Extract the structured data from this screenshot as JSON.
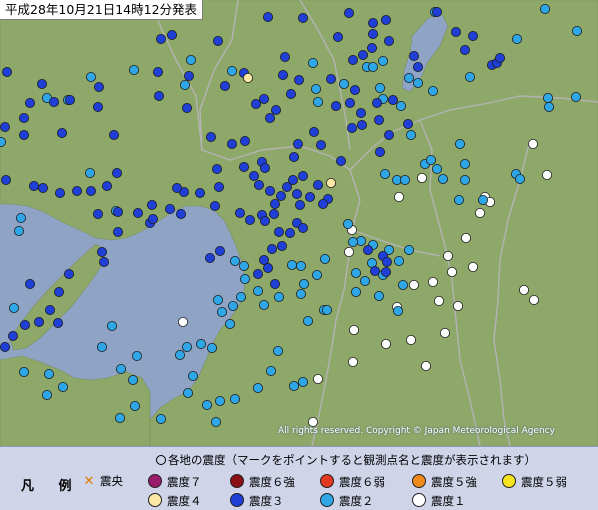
{
  "title": "平成28年10月21日14時12分発表",
  "copyright": "All rights reserved. Copyright © Japan Meteorological Agency",
  "legend": {
    "heading": "各地の震度（マークをポイントすると観測点名と震度が表示されます）",
    "label": "凡 例",
    "items": [
      {
        "key": "epicenter",
        "label": "震央",
        "symbol": "x-icon",
        "color": "#e8881a"
      },
      {
        "key": "s7",
        "label": "震度７",
        "color": "#9a1a6b"
      },
      {
        "key": "s6p",
        "label": "震度６強",
        "color": "#8a0f17"
      },
      {
        "key": "s6m",
        "label": "震度６弱",
        "color": "#e23a21"
      },
      {
        "key": "s5p",
        "label": "震度５強",
        "color": "#f08a1a"
      },
      {
        "key": "s5m",
        "label": "震度５弱",
        "color": "#f5e41e"
      },
      {
        "key": "s4",
        "label": "震度４",
        "color": "#fbe7a6"
      },
      {
        "key": "s3",
        "label": "震度３",
        "color": "#1f3fd6"
      },
      {
        "key": "s2",
        "label": "震度２",
        "color": "#2fa6e6"
      },
      {
        "key": "s1",
        "label": "震度１",
        "color": "#ffffff"
      }
    ]
  },
  "map_colors": {
    "land": "#8ea86a",
    "sea": "#8fa4c4",
    "border": "#a9a9a9"
  },
  "stations": {
    "s4": [
      [
        248,
        78
      ],
      [
        331,
        183
      ]
    ],
    "s3": [
      [
        7,
        72
      ],
      [
        42,
        84
      ],
      [
        30,
        103
      ],
      [
        54,
        102
      ],
      [
        70,
        100
      ],
      [
        24,
        118
      ],
      [
        5,
        127
      ],
      [
        62,
        133
      ],
      [
        24,
        135
      ],
      [
        99,
        87
      ],
      [
        98,
        107
      ],
      [
        114,
        135
      ],
      [
        117,
        173
      ],
      [
        107,
        186
      ],
      [
        91,
        191
      ],
      [
        77,
        191
      ],
      [
        60,
        193
      ],
      [
        43,
        188
      ],
      [
        6,
        180
      ],
      [
        34,
        186
      ],
      [
        152,
        205
      ],
      [
        138,
        213
      ],
      [
        150,
        223
      ],
      [
        153,
        219
      ],
      [
        118,
        232
      ],
      [
        98,
        214
      ],
      [
        118,
        212
      ],
      [
        184,
        192
      ],
      [
        200,
        193
      ],
      [
        219,
        187
      ],
      [
        177,
        188
      ],
      [
        170,
        209
      ],
      [
        181,
        214
      ],
      [
        215,
        206
      ],
      [
        217,
        169
      ],
      [
        211,
        137
      ],
      [
        232,
        144
      ],
      [
        244,
        167
      ],
      [
        245,
        141
      ],
      [
        262,
        162
      ],
      [
        254,
        176
      ],
      [
        265,
        168
      ],
      [
        259,
        185
      ],
      [
        270,
        191
      ],
      [
        275,
        204
      ],
      [
        281,
        196
      ],
      [
        287,
        187
      ],
      [
        293,
        180
      ],
      [
        297,
        194
      ],
      [
        303,
        176
      ],
      [
        300,
        205
      ],
      [
        310,
        197
      ],
      [
        318,
        185
      ],
      [
        328,
        199
      ],
      [
        321,
        145
      ],
      [
        314,
        132
      ],
      [
        298,
        144
      ],
      [
        294,
        157
      ],
      [
        270,
        118
      ],
      [
        276,
        110
      ],
      [
        291,
        94
      ],
      [
        283,
        75
      ],
      [
        285,
        57
      ],
      [
        256,
        104
      ],
      [
        264,
        99
      ],
      [
        299,
        80
      ],
      [
        336,
        106
      ],
      [
        331,
        79
      ],
      [
        353,
        60
      ],
      [
        363,
        55
      ],
      [
        355,
        90
      ],
      [
        350,
        103
      ],
      [
        361,
        113
      ],
      [
        352,
        128
      ],
      [
        362,
        125
      ],
      [
        341,
        161
      ],
      [
        323,
        204
      ],
      [
        274,
        214
      ],
      [
        262,
        215
      ],
      [
        279,
        232
      ],
      [
        272,
        249
      ],
      [
        282,
        246
      ],
      [
        264,
        260
      ],
      [
        268,
        268
      ],
      [
        258,
        274
      ],
      [
        275,
        284
      ],
      [
        240,
        213
      ],
      [
        250,
        220
      ],
      [
        265,
        221
      ],
      [
        297,
        223
      ],
      [
        303,
        228
      ],
      [
        290,
        233
      ],
      [
        244,
        73
      ],
      [
        225,
        86
      ],
      [
        189,
        76
      ],
      [
        187,
        108
      ],
      [
        159,
        96
      ],
      [
        158,
        72
      ],
      [
        161,
        39
      ],
      [
        218,
        41
      ],
      [
        268,
        17
      ],
      [
        303,
        18
      ],
      [
        338,
        37
      ],
      [
        349,
        13
      ],
      [
        373,
        34
      ],
      [
        373,
        23
      ],
      [
        386,
        20
      ],
      [
        389,
        41
      ],
      [
        372,
        48
      ],
      [
        377,
        103
      ],
      [
        379,
        120
      ],
      [
        393,
        100
      ],
      [
        414,
        56
      ],
      [
        418,
        67
      ],
      [
        456,
        32
      ],
      [
        465,
        50
      ],
      [
        437,
        12
      ],
      [
        473,
        36
      ],
      [
        492,
        65
      ],
      [
        497,
        63
      ],
      [
        500,
        58
      ],
      [
        389,
        135
      ],
      [
        380,
        152
      ],
      [
        408,
        124
      ],
      [
        368,
        250
      ],
      [
        383,
        256
      ],
      [
        387,
        262
      ],
      [
        375,
        271
      ],
      [
        386,
        272
      ],
      [
        69,
        274
      ],
      [
        59,
        292
      ],
      [
        50,
        310
      ],
      [
        30,
        284
      ],
      [
        102,
        252
      ],
      [
        104,
        262
      ],
      [
        58,
        323
      ],
      [
        39,
        322
      ],
      [
        25,
        325
      ],
      [
        13,
        336
      ],
      [
        5,
        347
      ],
      [
        178,
        9
      ],
      [
        172,
        35
      ],
      [
        210,
        258
      ],
      [
        220,
        251
      ]
    ],
    "s2": [
      [
        1,
        142
      ],
      [
        21,
        218
      ],
      [
        19,
        231
      ],
      [
        14,
        308
      ],
      [
        24,
        372
      ],
      [
        49,
        374
      ],
      [
        63,
        387
      ],
      [
        47,
        395
      ],
      [
        112,
        326
      ],
      [
        102,
        347
      ],
      [
        121,
        369
      ],
      [
        133,
        380
      ],
      [
        137,
        356
      ],
      [
        135,
        406
      ],
      [
        120,
        418
      ],
      [
        161,
        419
      ],
      [
        180,
        355
      ],
      [
        187,
        347
      ],
      [
        212,
        348
      ],
      [
        193,
        376
      ],
      [
        201,
        344
      ],
      [
        222,
        312
      ],
      [
        230,
        324
      ],
      [
        233,
        306
      ],
      [
        241,
        297
      ],
      [
        245,
        279
      ],
      [
        258,
        291
      ],
      [
        279,
        297
      ],
      [
        292,
        265
      ],
      [
        301,
        266
      ],
      [
        301,
        294
      ],
      [
        304,
        284
      ],
      [
        317,
        275
      ],
      [
        325,
        259
      ],
      [
        308,
        321
      ],
      [
        324,
        310
      ],
      [
        271,
        371
      ],
      [
        294,
        386
      ],
      [
        303,
        382
      ],
      [
        258,
        388
      ],
      [
        235,
        399
      ],
      [
        220,
        401
      ],
      [
        207,
        405
      ],
      [
        216,
        422
      ],
      [
        188,
        393
      ],
      [
        348,
        224
      ],
      [
        361,
        241
      ],
      [
        353,
        242
      ],
      [
        373,
        245
      ],
      [
        389,
        250
      ],
      [
        372,
        263
      ],
      [
        356,
        273
      ],
      [
        365,
        281
      ],
      [
        356,
        292
      ],
      [
        379,
        296
      ],
      [
        383,
        275
      ],
      [
        409,
        250
      ],
      [
        399,
        261
      ],
      [
        403,
        285
      ],
      [
        398,
        311
      ],
      [
        327,
        310
      ],
      [
        278,
        351
      ],
      [
        235,
        261
      ],
      [
        244,
        266
      ],
      [
        218,
        300
      ],
      [
        264,
        305
      ],
      [
        411,
        135
      ],
      [
        425,
        164
      ],
      [
        397,
        180
      ],
      [
        405,
        180
      ],
      [
        385,
        174
      ],
      [
        431,
        160
      ],
      [
        443,
        179
      ],
      [
        465,
        180
      ],
      [
        465,
        164
      ],
      [
        483,
        200
      ],
      [
        459,
        200
      ],
      [
        437,
        169
      ],
      [
        418,
        83
      ],
      [
        470,
        77
      ],
      [
        516,
        174
      ],
      [
        520,
        179
      ],
      [
        548,
        98
      ],
      [
        576,
        97
      ],
      [
        549,
        107
      ],
      [
        517,
        39
      ],
      [
        577,
        31
      ],
      [
        545,
        9
      ],
      [
        435,
        12
      ],
      [
        383,
        61
      ],
      [
        409,
        78
      ],
      [
        433,
        91
      ],
      [
        460,
        144
      ],
      [
        401,
        106
      ],
      [
        383,
        99
      ],
      [
        380,
        88
      ],
      [
        367,
        67
      ],
      [
        373,
        67
      ],
      [
        134,
        70
      ],
      [
        91,
        77
      ],
      [
        68,
        100
      ],
      [
        47,
        98
      ],
      [
        90,
        173
      ],
      [
        116,
        211
      ],
      [
        185,
        85
      ],
      [
        191,
        60
      ],
      [
        232,
        71
      ],
      [
        313,
        63
      ],
      [
        316,
        89
      ],
      [
        344,
        84
      ],
      [
        318,
        102
      ]
    ],
    "s1": [
      [
        547,
        175
      ],
      [
        533,
        144
      ],
      [
        485,
        197
      ],
      [
        480,
        213
      ],
      [
        352,
        230
      ],
      [
        349,
        252
      ],
      [
        354,
        330
      ],
      [
        397,
        307
      ],
      [
        414,
        285
      ],
      [
        433,
        282
      ],
      [
        473,
        267
      ],
      [
        452,
        272
      ],
      [
        439,
        301
      ],
      [
        458,
        306
      ],
      [
        524,
        290
      ],
      [
        534,
        300
      ],
      [
        445,
        333
      ],
      [
        386,
        344
      ],
      [
        411,
        340
      ],
      [
        353,
        362
      ],
      [
        426,
        366
      ],
      [
        318,
        379
      ],
      [
        313,
        422
      ],
      [
        208,
        452
      ],
      [
        183,
        322
      ],
      [
        399,
        197
      ],
      [
        422,
        178
      ],
      [
        466,
        238
      ],
      [
        490,
        202
      ],
      [
        448,
        256
      ]
    ]
  }
}
